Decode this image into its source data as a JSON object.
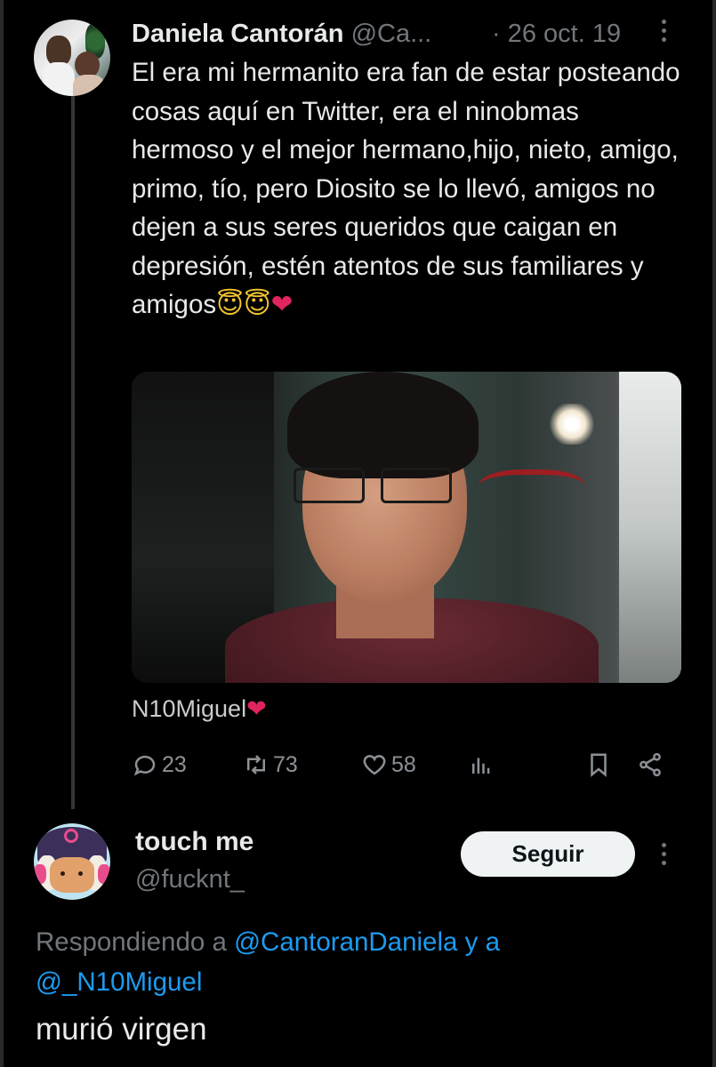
{
  "tweet": {
    "author_name": "Daniela Cantorán",
    "author_handle": "@Ca...",
    "separator": "·",
    "date": "26 oct. 19",
    "text": "El era mi hermanito era fan de estar posteando cosas aquí en Twitter, era el ninobmas hermoso y el mejor hermano,hijo, nieto, amigo, primo, tío, pero Diosito se lo llevó, amigos no dejen a sus seres queridos que caigan en depresión, estén atentos de sus familiares y amigos",
    "emojis": [
      "😇",
      "😇",
      "❤"
    ],
    "photo_caption": "N10Miguel",
    "caption_emoji": "❤",
    "metrics": {
      "replies": "23",
      "retweets": "73",
      "likes": "58"
    }
  },
  "reply": {
    "author_name": "touch me",
    "author_handle": "@fucknt_",
    "follow_label": "Seguir",
    "replying_prefix": "Respondiendo a",
    "replying_to_1": "@CantoranDaniela",
    "replying_joiner": "y a",
    "replying_to_2": "@_N10Miguel",
    "text": "murió virgen"
  },
  "colors": {
    "background": "#000000",
    "primary_text": "#e7e9ea",
    "secondary_text": "#71767b",
    "link": "#1d9bf0",
    "follow_button": "#eff3f4",
    "heart": "#e0245e"
  },
  "icons": [
    "reply-icon",
    "retweet-icon",
    "like-icon",
    "views-icon",
    "bookmark-icon",
    "share-icon",
    "more-icon"
  ]
}
